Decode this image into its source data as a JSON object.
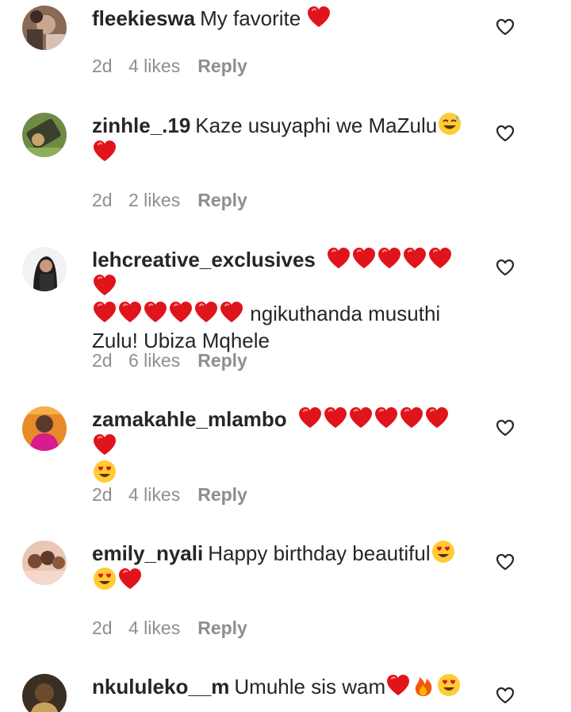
{
  "icons": {
    "like": "heart-outline-icon",
    "heart_emoji": "red-heart-emoji-icon",
    "sweat_smile": "grinning-sweat-emoji-icon",
    "heart_eyes": "heart-eyes-emoji-icon",
    "fire": "fire-emoji-icon"
  },
  "colors": {
    "text": "#262626",
    "meta": "#8e8e8e",
    "heart": "#e0141b"
  },
  "comments": [
    {
      "username": "fleekieswa",
      "text": "My favorite",
      "time": "2d",
      "likes": "4 likes",
      "reply": "Reply"
    },
    {
      "username": "zinhle_.19",
      "text": "Kaze usuyaphi we MaZulu",
      "time": "2d",
      "likes": "2 likes",
      "reply": "Reply"
    },
    {
      "username": "lehcreative_exclusives",
      "text": "ngikuthanda musuthi Zulu! Ubiza Mqhele",
      "time": "2d",
      "likes": "6 likes",
      "reply": "Reply"
    },
    {
      "username": "zamakahle_mlambo",
      "text": "",
      "time": "2d",
      "likes": "4 likes",
      "reply": "Reply"
    },
    {
      "username": "emily_nyali",
      "text": "Happy birthday beautiful",
      "time": "2d",
      "likes": "4 likes",
      "reply": "Reply"
    },
    {
      "username": "nkululeko__m",
      "text": "Umuhle sis wam"
    }
  ]
}
